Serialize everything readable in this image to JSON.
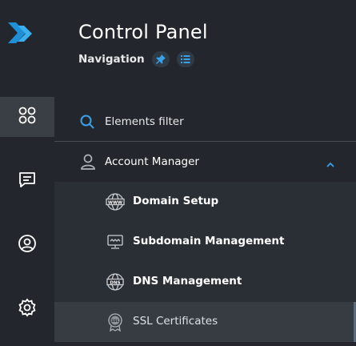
{
  "header": {
    "title": "Control Panel",
    "subtitle": "Navigation"
  },
  "rail": {
    "items": [
      "apps-icon",
      "chat-icon",
      "user-circle-icon",
      "settings-icon"
    ],
    "active": "apps-icon"
  },
  "filter": {
    "placeholder": "Elements filter"
  },
  "menu": {
    "group_label": "Account Manager",
    "items": [
      {
        "label": "Domain Setup",
        "icon": "www-globe-icon"
      },
      {
        "label": "Subdomain Management",
        "icon": "monitor-icon"
      },
      {
        "label": "DNS Management",
        "icon": "dns-globe-icon"
      },
      {
        "label": "SSL Certificates",
        "icon": "ssl-badge-icon",
        "selected": true
      }
    ]
  },
  "colors": {
    "accent": "#3aa0e8",
    "background": "#23272d",
    "subitem_bg": "#2a2f35",
    "selected_bg": "#373c43"
  }
}
